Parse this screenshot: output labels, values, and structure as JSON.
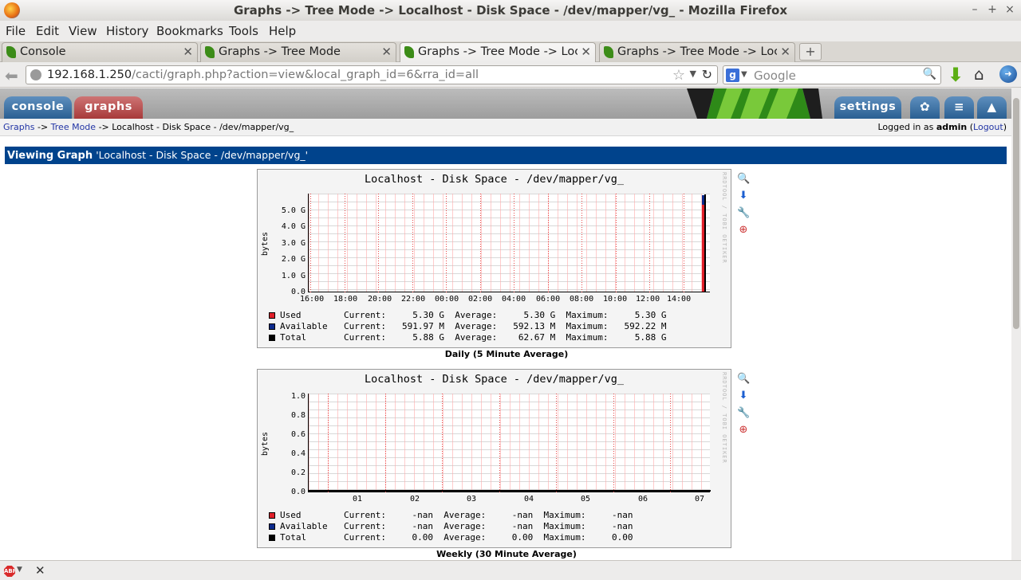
{
  "window": {
    "title": "Graphs -> Tree Mode -> Localhost - Disk Space - /dev/mapper/vg_ - Mozilla Firefox"
  },
  "menubar": [
    "File",
    "Edit",
    "View",
    "History",
    "Bookmarks",
    "Tools",
    "Help"
  ],
  "tabs": [
    {
      "label": "Console"
    },
    {
      "label": "Graphs -> Tree Mode"
    },
    {
      "label": "Graphs -> Tree Mode -> Loca..."
    },
    {
      "label": "Graphs -> Tree Mode -> Loca..."
    }
  ],
  "url": {
    "host": "192.168.1.250",
    "path": "/cacti/graph.php?action=view&local_graph_id=6&rra_id=all"
  },
  "search": {
    "placeholder": "Google"
  },
  "cacti": {
    "tabs": {
      "console": "console",
      "graphs": "graphs",
      "settings": "settings"
    },
    "breadcrumb": {
      "graphs": "Graphs",
      "sep": "->",
      "tree": "Tree Mode",
      "current": "Localhost - Disk Space - /dev/mapper/vg_"
    },
    "login": {
      "prefix": "Logged in as",
      "user": "admin",
      "logout": "Logout"
    },
    "viewing": {
      "label": "Viewing Graph",
      "name": "'Localhost - Disk Space - /dev/mapper/vg_'"
    }
  },
  "graphs": [
    {
      "title": "Localhost - Disk Space - /dev/mapper/vg_",
      "ylabel": "bytes",
      "side_text": "RRDTOOL / TOBI OETIKER",
      "caption": "Daily (5 Minute Average)",
      "yticks": [
        "5.0 G",
        "4.0 G",
        "3.0 G",
        "2.0 G",
        "1.0 G",
        "0.0"
      ],
      "xticks": [
        "16:00",
        "18:00",
        "20:00",
        "22:00",
        "00:00",
        "02:00",
        "04:00",
        "06:00",
        "08:00",
        "10:00",
        "12:00",
        "14:00"
      ],
      "legend": [
        {
          "name": "Used",
          "color": "#e0202a",
          "current": "5.30 G",
          "average": "5.30 G",
          "maximum": "5.30 G"
        },
        {
          "name": "Available",
          "color": "#0c2a8c",
          "current": "591.97 M",
          "average": "592.13 M",
          "maximum": "592.22 M"
        },
        {
          "name": "Total",
          "color": "#000000",
          "current": "5.88 G",
          "average": "62.67 M",
          "maximum": "5.88 G"
        }
      ],
      "labels": {
        "current": "Current:",
        "average": "Average:",
        "maximum": "Maximum:"
      }
    },
    {
      "title": "Localhost - Disk Space - /dev/mapper/vg_",
      "ylabel": "bytes",
      "side_text": "RRDTOOL / TOBI OETIKER",
      "caption": "Weekly (30 Minute Average)",
      "yticks": [
        "1.0",
        "0.8",
        "0.6",
        "0.4",
        "0.2",
        "0.0"
      ],
      "xticks": [
        "01",
        "02",
        "03",
        "04",
        "05",
        "06",
        "07"
      ],
      "legend": [
        {
          "name": "Used",
          "color": "#e0202a",
          "current": "-nan",
          "average": "-nan",
          "maximum": "-nan"
        },
        {
          "name": "Available",
          "color": "#0c2a8c",
          "current": "-nan",
          "average": "-nan",
          "maximum": "-nan"
        },
        {
          "name": "Total",
          "color": "#000000",
          "current": "0.00",
          "average": "0.00",
          "maximum": "0.00"
        }
      ],
      "labels": {
        "current": "Current:",
        "average": "Average:",
        "maximum": "Maximum:"
      }
    }
  ],
  "icons": {
    "graph_actions": [
      "zoom-icon",
      "csv-export-icon",
      "properties-icon",
      "timespan-icon"
    ],
    "header": [
      "tree-view-icon",
      "list-view-icon",
      "preview-icon"
    ]
  },
  "colors": {
    "accent": "#00438c",
    "console_tab": "#2a5f92",
    "graphs_tab": "#a73a3a"
  }
}
